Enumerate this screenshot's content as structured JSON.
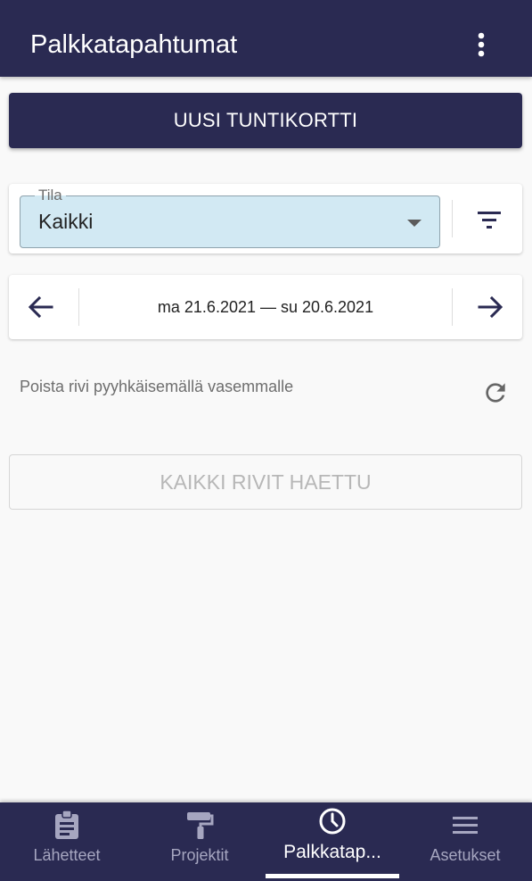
{
  "appbar": {
    "title": "Palkkatapahtumat",
    "menu_icon": "more-vert-icon"
  },
  "actions": {
    "new_timecard_label": "UUSI TUNTIKORTTI"
  },
  "filter": {
    "status_label": "Tila",
    "status_value": "Kaikki",
    "filter_icon": "filter-list-icon"
  },
  "date_range": {
    "text": "ma 21.6.2021 — su 20.6.2021",
    "prev_icon": "arrow-left-icon",
    "next_icon": "arrow-right-icon"
  },
  "hint": {
    "text": "Poista rivi pyyhkäisemällä vasemmalle",
    "refresh_icon": "refresh-icon"
  },
  "list_end": {
    "label": "KAIKKI RIVIT HAETTU"
  },
  "bottom_nav": {
    "items": [
      {
        "label": "Lähetteet",
        "icon": "clipboard-icon",
        "active": false
      },
      {
        "label": "Projektit",
        "icon": "paint-roller-icon",
        "active": false
      },
      {
        "label": "Palkkatap...",
        "icon": "clock-icon",
        "active": true
      },
      {
        "label": "Asetukset",
        "icon": "menu-icon",
        "active": false
      }
    ]
  },
  "colors": {
    "primary": "#2a2a52",
    "select_background": "#d2e9f3",
    "background": "#f9f9f9",
    "nav_inactive": "#a6a6c0"
  }
}
